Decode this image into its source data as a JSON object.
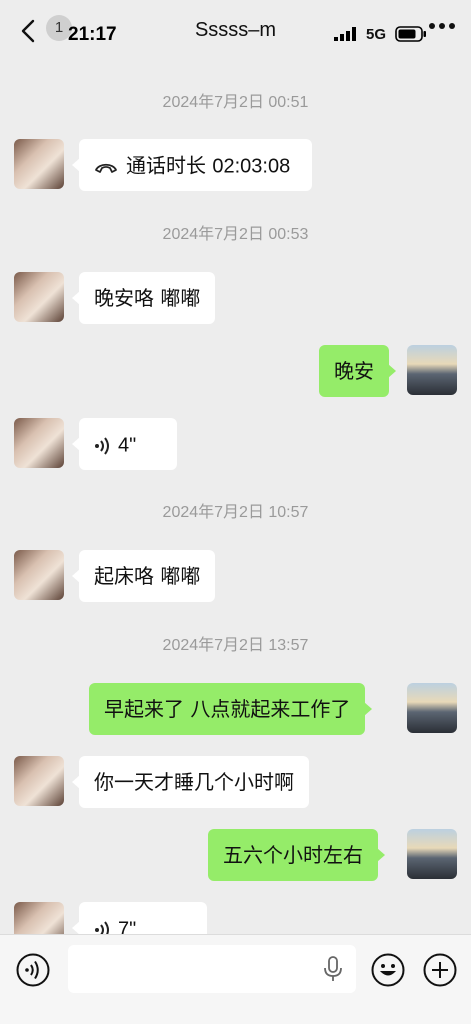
{
  "status": {
    "time": "21:17",
    "network": "5G"
  },
  "header": {
    "title": "Sssss–m",
    "unread_badge": "1"
  },
  "messages": [
    {
      "kind": "timestamp",
      "text": "2024年7月2日 00:51"
    },
    {
      "kind": "call",
      "from": "them",
      "label": "通话时长",
      "duration": "02:03:08"
    },
    {
      "kind": "timestamp",
      "text": "2024年7月2日 00:53"
    },
    {
      "kind": "text",
      "from": "them",
      "text": "晚安咯 嘟嘟"
    },
    {
      "kind": "text",
      "from": "me",
      "text": "晚安"
    },
    {
      "kind": "voice",
      "from": "them",
      "duration": "4\""
    },
    {
      "kind": "timestamp",
      "text": "2024年7月2日 10:57"
    },
    {
      "kind": "text",
      "from": "them",
      "text": "起床咯 嘟嘟"
    },
    {
      "kind": "timestamp",
      "text": "2024年7月2日 13:57"
    },
    {
      "kind": "text",
      "from": "me",
      "text": "早起来了 八点就起来工作了"
    },
    {
      "kind": "text",
      "from": "them",
      "text": "你一天才睡几个小时啊"
    },
    {
      "kind": "text",
      "from": "me",
      "text": "五六个小时左右"
    },
    {
      "kind": "voice",
      "from": "them",
      "duration": "7\""
    }
  ],
  "input": {
    "value": ""
  },
  "icons": {
    "back": "chevron-left-icon",
    "more": "more-dots-icon",
    "call": "phone-hangup-icon",
    "voice": "voice-wave-icon",
    "mic": "microphone-icon",
    "emoji": "emoji-smile-icon",
    "plus": "plus-circle-icon"
  },
  "colors": {
    "outgoing_bubble": "#95ec69",
    "incoming_bubble": "#ffffff",
    "background": "#ededed"
  }
}
